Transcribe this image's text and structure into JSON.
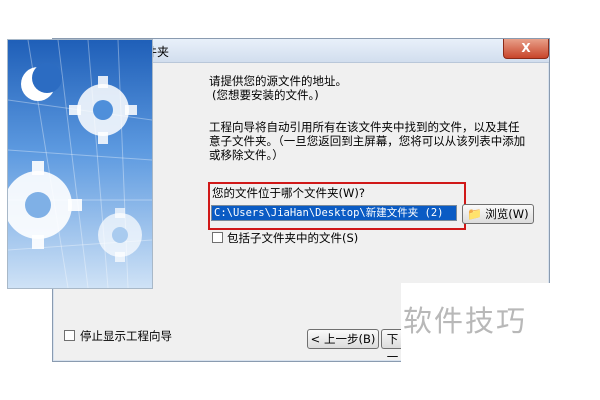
{
  "window": {
    "title": "工程向导 - 源文件夹",
    "close_label": "X"
  },
  "intro": {
    "line1": "请提供您的源文件的地址。",
    "line2": "(您想要安装的文件。)",
    "para1": "工程向导将自动引用所有在该文件夹中找到的文件，以及其任",
    "para2": "意子文件夹。（一旦您返回到主屏幕，您将可以从该列表中添加",
    "para3": "或移除文件。）"
  },
  "folder": {
    "question": "您的文件位于哪个文件夹(W)?",
    "path_value": "C:\\Users\\JiaHan\\Desktop\\新建文件夹 (2)",
    "browse_label": "浏览(W)",
    "include_subfolders_label": "包括子文件夹中的文件(S)",
    "include_subfolders_checked": false
  },
  "footer": {
    "stop_wizard_label": "停止显示工程向导",
    "stop_wizard_checked": false,
    "back_label": "< 上一步(B)",
    "next_label": "下一"
  },
  "watermark": {
    "text": "软件技巧"
  },
  "colors": {
    "highlight_border": "#d01818",
    "selection_bg": "#0a5bc4",
    "art_blue": "#3d7fd0"
  }
}
